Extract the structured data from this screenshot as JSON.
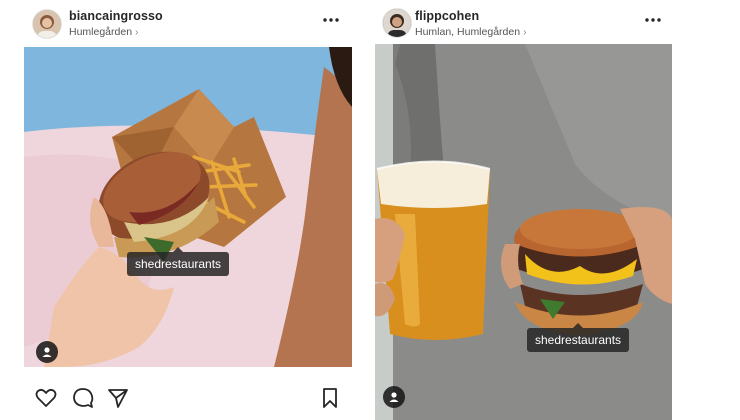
{
  "posts": [
    {
      "username": "biancaingrosso",
      "location": "Humlegården",
      "location_chevron": "›",
      "product_tag": "shedrestaurants"
    },
    {
      "username": "flippcohen",
      "location": "Humlan, Humlegården",
      "location_chevron": "›",
      "product_tag": "shedrestaurants"
    }
  ],
  "icons": {
    "more": "more-options-icon",
    "user_tag": "user-tag-icon",
    "like": "heart-icon",
    "comment": "comment-icon",
    "share": "share-icon",
    "save": "bookmark-icon"
  },
  "colors": {
    "text": "#262626",
    "tag_bg": "#262626"
  }
}
